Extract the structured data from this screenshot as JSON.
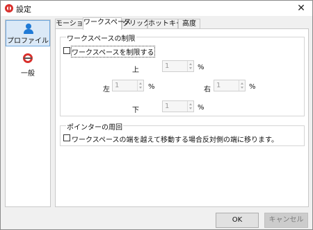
{
  "window": {
    "title": "設定",
    "close_glyph": "✕",
    "app_icon": "settings-app-icon"
  },
  "sidebar": {
    "items": [
      {
        "label": "プロファイル",
        "icon": "user-icon",
        "selected": true
      },
      {
        "label": "一般",
        "icon": "general-icon",
        "selected": false
      }
    ]
  },
  "tabs": [
    {
      "label": "モーション",
      "active": false
    },
    {
      "label": "ワークスペース",
      "active": true
    },
    {
      "label": "クリック",
      "active": false
    },
    {
      "label": "ホットキー",
      "active": false
    },
    {
      "label": "高度",
      "active": false
    }
  ],
  "workspace_limit": {
    "group_title": "ワークスペースの制限",
    "checkbox_label": "ワークスペースを制限する",
    "checked": false,
    "top": {
      "label": "上",
      "value": "1",
      "unit": "%"
    },
    "left": {
      "label": "左",
      "value": "1",
      "unit": "%"
    },
    "right": {
      "label": "右",
      "value": "1",
      "unit": "%"
    },
    "bottom": {
      "label": "下",
      "value": "1",
      "unit": "%"
    }
  },
  "pointer_wrap": {
    "group_title": "ポインターの周回",
    "checkbox_label": "ワークスペースの端を越えて移動する場合反対側の端に移ります。",
    "checked": false
  },
  "buttons": {
    "ok": "OK",
    "cancel": "キャンセル(C)"
  },
  "colors": {
    "accent": "#1f7ad6",
    "brand": "#d9302c",
    "selection": "#dbe9f7"
  }
}
